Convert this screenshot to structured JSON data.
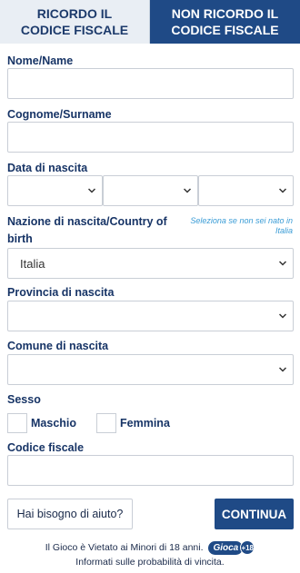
{
  "tabs": {
    "recall": "RICORDO IL\nCODICE FISCALE",
    "not_recall": "NON RICORDO IL\nCODICE FISCALE"
  },
  "form": {
    "name_label": "Nome/Name",
    "surname_label": "Cognome/Surname",
    "birthdate_label": "Data di nascita",
    "country_label_line1": "Nazione di nascita/Country of",
    "country_label_line2": "birth",
    "country_helper": "Seleziona se non sei nato in Italia",
    "country_value": "Italia",
    "province_label": "Provincia di nascita",
    "comune_label": "Comune di nascita",
    "sex_label": "Sesso",
    "male_label": "Maschio",
    "female_label": "Femmina",
    "fiscal_code_label": "Codice fiscale"
  },
  "actions": {
    "help": "Hai bisogno di aiuto?",
    "continue": "CONTINUA"
  },
  "footer": {
    "line1": "Il Gioco è Vietato ai Minori di 18 anni.",
    "badge_text": "Gioca",
    "badge_age": "+18",
    "line2": "Informati sulle probabilità di vincita."
  },
  "colors": {
    "brand": "#1f4a86",
    "helper": "#3a9cd6",
    "label": "#173466"
  }
}
